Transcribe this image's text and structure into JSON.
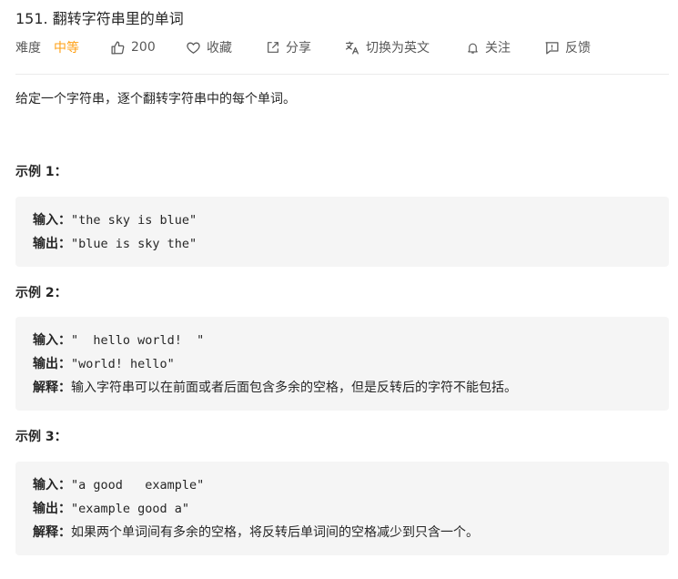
{
  "problem": {
    "title": "151. 翻转字符串里的单词",
    "difficulty_label": "难度",
    "difficulty_value": "中等",
    "likes": "200",
    "favorite_label": "收藏",
    "share_label": "分享",
    "switch_lang_label": "切换为英文",
    "follow_label": "关注",
    "feedback_label": "反馈",
    "description": "给定一个字符串，逐个翻转字符串中的每个单词。"
  },
  "examples": [
    {
      "title": "示例 1：",
      "input_label": "输入：",
      "input": "\"the sky is blue\"",
      "output_label": "输出：",
      "output": "\"blue is sky the\""
    },
    {
      "title": "示例 2：",
      "input_label": "输入：",
      "input": "\"  hello world!  \"",
      "output_label": "输出：",
      "output": "\"world! hello\"",
      "explanation_label": "解释：",
      "explanation": "输入字符串可以在前面或者后面包含多余的空格，但是反转后的字符不能包括。"
    },
    {
      "title": "示例 3：",
      "input_label": "输入：",
      "input": "\"a good   example\"",
      "output_label": "输出：",
      "output": "\"example good a\"",
      "explanation_label": "解释：",
      "explanation": "如果两个单词间有多余的空格，将反转后单词间的空格减少到只含一个。"
    }
  ],
  "colors": {
    "accent_medium": "#ffa116",
    "text": "#262626",
    "muted": "#595959",
    "code_bg": "#f5f5f5"
  },
  "icons": [
    "thumbs-up-icon",
    "heart-icon",
    "share-icon",
    "translate-icon",
    "bell-icon",
    "feedback-icon"
  ]
}
